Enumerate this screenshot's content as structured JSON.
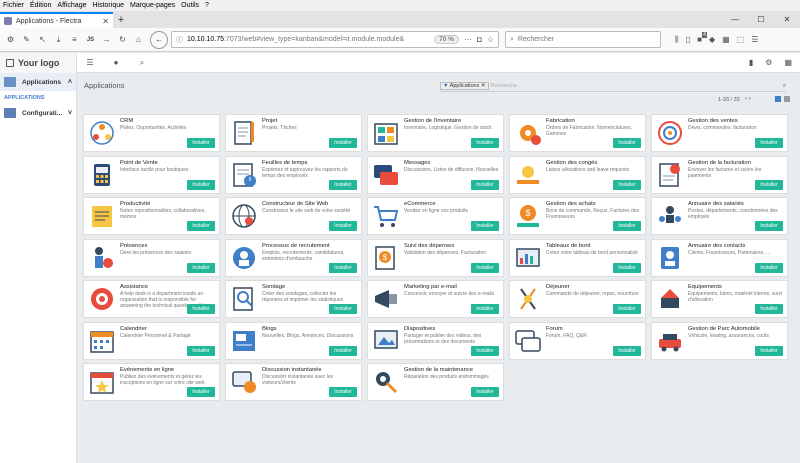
{
  "menubar": [
    "Fichier",
    "Édition",
    "Affichage",
    "Historique",
    "Marque-pages",
    "Outils",
    "?"
  ],
  "browser": {
    "tab_title": "Applications - Flectra",
    "url_host": "10.10.10.75",
    "url_rest": ":7073/web#view_type=kanban&model=ir.module.module&",
    "zoom": "70 %",
    "search_placeholder": "Rechercher",
    "badge": "4"
  },
  "app": {
    "logo": "Your logo",
    "sidebar": [
      {
        "label": "Applications",
        "active": true
      },
      {
        "label": "Configurati...",
        "active": false
      }
    ],
    "sub_label": "APPLICATIONS",
    "breadcrumb": "Applications",
    "facet_label": "Applications",
    "search_placeholder": "Recherche...",
    "pager": "1-33 / 33",
    "install_label": "Installer"
  },
  "accent": "#21b799",
  "apps": [
    {
      "name": "CRM",
      "desc": "Pistes, Opportunités, Activités",
      "icon": "crm"
    },
    {
      "name": "Projet",
      "desc": "Projets, Tâches",
      "icon": "project"
    },
    {
      "name": "Gestion de l'inventaire",
      "desc": "Inventaire, Logistique, Gestion de stock",
      "icon": "inventory"
    },
    {
      "name": "Fabrication",
      "desc": "Ordres de Fabrication, Nomenclatures, Gammes",
      "icon": "mrp"
    },
    {
      "name": "Gestion des ventes",
      "desc": "Devis, commandes, facturation",
      "icon": "sales"
    },
    {
      "name": "Point de Vente",
      "desc": "Interface tactile pour boutiques",
      "icon": "pos"
    },
    {
      "name": "Feuilles de temps",
      "desc": "Exprimez et approuvez les rapports de temps des employés",
      "icon": "timesheet"
    },
    {
      "name": "Messages",
      "desc": "Discussions, Listes de diffusion, Nouvelles",
      "icon": "messages"
    },
    {
      "name": "Gestion des congés",
      "desc": "Laisse allocations and leave requests",
      "icon": "leaves"
    },
    {
      "name": "Gestion de la facturation",
      "desc": "Envoyer les factures et suivre les paiements",
      "icon": "invoicing"
    },
    {
      "name": "Productivité",
      "desc": "Notes repositionnables, collaboratives, mémos",
      "icon": "notes"
    },
    {
      "name": "Constructeur de Site Web",
      "desc": "Construisez le site web de votre société",
      "icon": "website"
    },
    {
      "name": "eCommerce",
      "desc": "Vendez en ligne vos produits",
      "icon": "ecommerce"
    },
    {
      "name": "Gestion des achats",
      "desc": "Bons de commande, Reçus, Factures des Fournisseurs",
      "icon": "purchase"
    },
    {
      "name": "Annuaire des salariés",
      "desc": "Postes, départements, coordonnées des employés",
      "icon": "employees"
    },
    {
      "name": "Présences",
      "desc": "Gère les présences des salariés",
      "icon": "attendance"
    },
    {
      "name": "Processus de recrutement",
      "desc": "Emplois, recrutements, candidatures, entretiens d'embauche",
      "icon": "recruitment"
    },
    {
      "name": "Suivi des dépenses",
      "desc": "Validation des dépenses, Facturation",
      "icon": "expenses"
    },
    {
      "name": "Tableaux de bord",
      "desc": "Créez votre tableau de bord personnalisé",
      "icon": "dashboards"
    },
    {
      "name": "Annuaire des contacts",
      "desc": "Clients, Fournisseurs, Partenaires, ...",
      "icon": "contacts"
    },
    {
      "name": "Assistance",
      "desc": "A help desk is a department inside an organization that is responsible for answering the technical questions of its users.",
      "icon": "helpdesk"
    },
    {
      "name": "Sondage",
      "desc": "Créer des sondages, collecter les réponses et imprimer les statistiques",
      "icon": "survey"
    },
    {
      "name": "Marketing par e-mail",
      "desc": "Concevoir, envoyer et suivre des e-mails",
      "icon": "mailing"
    },
    {
      "name": "Déjeuner",
      "desc": "Commande de déjeuner, repas, nourriture",
      "icon": "lunch"
    },
    {
      "name": "Equipements",
      "desc": "Equipements, biens, matériel interne, suivi d'allocation",
      "icon": "equipment"
    },
    {
      "name": "Calendrier",
      "desc": "Calendrier Personnel & Partagé",
      "icon": "calendar"
    },
    {
      "name": "Blogs",
      "desc": "Nouvelles, Blogs, Annonces, Discussions",
      "icon": "blogs"
    },
    {
      "name": "Diapositives",
      "desc": "Partager et publier des vidéos, des présentations et des documents",
      "icon": "slides"
    },
    {
      "name": "Forum",
      "desc": "Forum, FAQ, Q&R",
      "icon": "forum"
    },
    {
      "name": "Gestion de Parc Automobile",
      "desc": "Véhicule, leasing, assurances, coûts",
      "icon": "fleet"
    },
    {
      "name": "Événements en ligne",
      "desc": "Publiez des événements et gérez les inscriptions en ligne sur votre site web",
      "icon": "events"
    },
    {
      "name": "Discussion instantanée",
      "desc": "Discussion instantanée avec les visiteurs/clients",
      "icon": "livechat"
    },
    {
      "name": "Gestion de la maintenance",
      "desc": "Réparation des produits endommagés",
      "icon": "maintenance"
    }
  ]
}
